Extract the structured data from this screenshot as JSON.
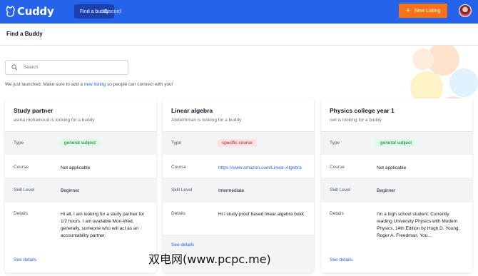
{
  "app": {
    "name": "Cuddy"
  },
  "nav": {
    "find_buddy": "Find a buddy",
    "discord": "Discord"
  },
  "header": {
    "new_listing": "New Listing"
  },
  "page": {
    "title": "Find a Buddy"
  },
  "search": {
    "placeholder": "Search",
    "value": ""
  },
  "notice": {
    "prefix": "We just launched. Make sure to add a ",
    "link": "new listing",
    "suffix": " so people can connect with you!"
  },
  "labels": {
    "type": "Type",
    "course": "Course",
    "skill_level": "Skill Level",
    "details": "Details",
    "see_details": "See details"
  },
  "cards": [
    {
      "title": "Study partner",
      "subtitle": "asma mohamoud is looking for a buddy",
      "type": "general subject",
      "type_color": "green",
      "course": "Not applicable",
      "skill_level": "Beginner",
      "details": "Hi all, I am looking for a study partner for 1/2 hours. I am available Mon-Wed, generally, someone who will act as an accountability partner."
    },
    {
      "title": "Linear algebra",
      "subtitle": "Abdelrhman is looking for a buddy",
      "type": "specific course",
      "type_color": "red",
      "course": "https://www.amazon.com/Linear-Algebra",
      "skill_level": "Intermediate",
      "details": "Hi I study proof based linear algebra bokk"
    },
    {
      "title": "Physics college year 1",
      "subtitle": "owl is looking for a buddy",
      "type": "general subject",
      "type_color": "green",
      "course": "Not applicable",
      "skill_level": "Beginner",
      "details": "I'm a high school student. Currently reading University Physics with Modern Physics, 14th Edition by Hugh D. Young, Roger A. Freedman. You..."
    }
  ],
  "watermark": "双电网(www.pcpc.me)",
  "colors": {
    "brand": "#2563eb",
    "accent": "#f97316"
  }
}
